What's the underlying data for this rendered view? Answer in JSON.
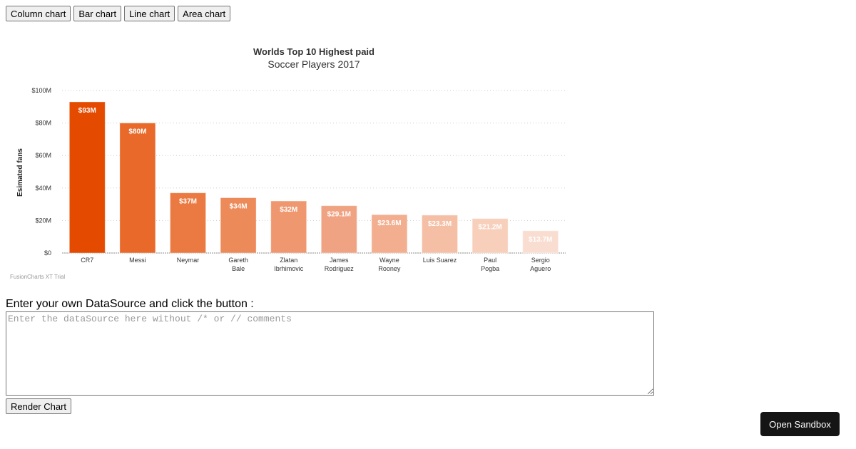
{
  "toolbar": {
    "buttons": [
      "Column chart",
      "Bar chart",
      "Line chart",
      "Area chart"
    ]
  },
  "chart_data": {
    "type": "bar",
    "title": "Worlds Top 10 Highest paid",
    "subtitle": "Soccer Players 2017",
    "ylabel": "Esimated fans",
    "xlabel": "",
    "ylim": [
      0,
      100
    ],
    "yticks": [
      "$0",
      "$20M",
      "$40M",
      "$60M",
      "$80M",
      "$100M"
    ],
    "categories": [
      [
        "CR7"
      ],
      [
        "Messi"
      ],
      [
        "Neymar"
      ],
      [
        "Gareth",
        "Bale"
      ],
      [
        "Zlatan",
        "Ibrhimovic"
      ],
      [
        "James",
        "Rodriguez"
      ],
      [
        "Wayne",
        "Rooney"
      ],
      [
        "Luis Suarez"
      ],
      [
        "Paul",
        "Pogba"
      ],
      [
        "Sergio",
        "Aguero"
      ]
    ],
    "values": [
      93,
      80,
      37,
      34,
      32,
      29.1,
      23.6,
      23.3,
      21.2,
      13.7
    ],
    "labels": [
      "$93M",
      "$80M",
      "$37M",
      "$34M",
      "$32M",
      "$29.1M",
      "$23.6M",
      "$23.3M",
      "$21.2M",
      "$13.7M"
    ],
    "colors": [
      "#e44a00",
      "#e8692a",
      "#ea7a42",
      "#ed8a5a",
      "#ef9870",
      "#f0a382",
      "#f2ae8f",
      "#f4bfa5",
      "#f7cfbb",
      "#f9ddd0"
    ],
    "grid": true,
    "watermark": "FusionCharts XT Trial"
  },
  "form": {
    "prompt": "Enter your own DataSource and click the button :",
    "placeholder": "Enter the dataSource here without /* or // comments",
    "render_label": "Render Chart"
  },
  "sandbox_label": "Open Sandbox"
}
